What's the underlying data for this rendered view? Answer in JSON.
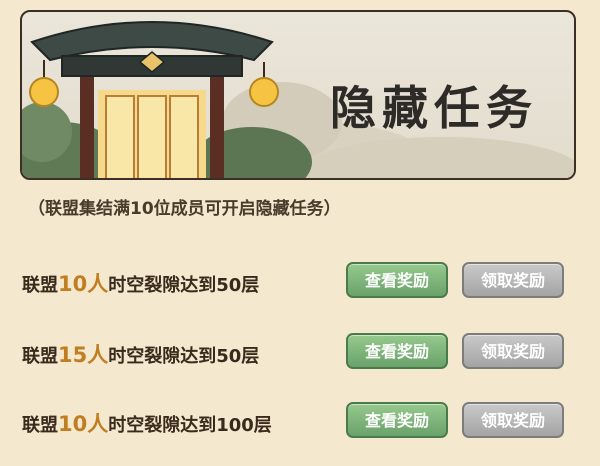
{
  "banner": {
    "title": "隐藏任务"
  },
  "notice": "（联盟集结满10位成员可开启隐藏任务）",
  "tasks": [
    {
      "prefix": "联盟",
      "highlight": "10人",
      "suffix": "时空裂隙达到50层",
      "view_label": "查看奖励",
      "claim_label": "领取奖励"
    },
    {
      "prefix": "联盟",
      "highlight": "15人",
      "suffix": "时空裂隙达到50层",
      "view_label": "查看奖励",
      "claim_label": "领取奖励"
    },
    {
      "prefix": "联盟",
      "highlight": "10人",
      "suffix": "时空裂隙达到100层",
      "view_label": "查看奖励",
      "claim_label": "领取奖励"
    }
  ],
  "colors": {
    "highlight": "#c07e20",
    "view_button": "#7ab376",
    "claim_button": "#b3b3b3",
    "background": "#f4e8cf"
  }
}
